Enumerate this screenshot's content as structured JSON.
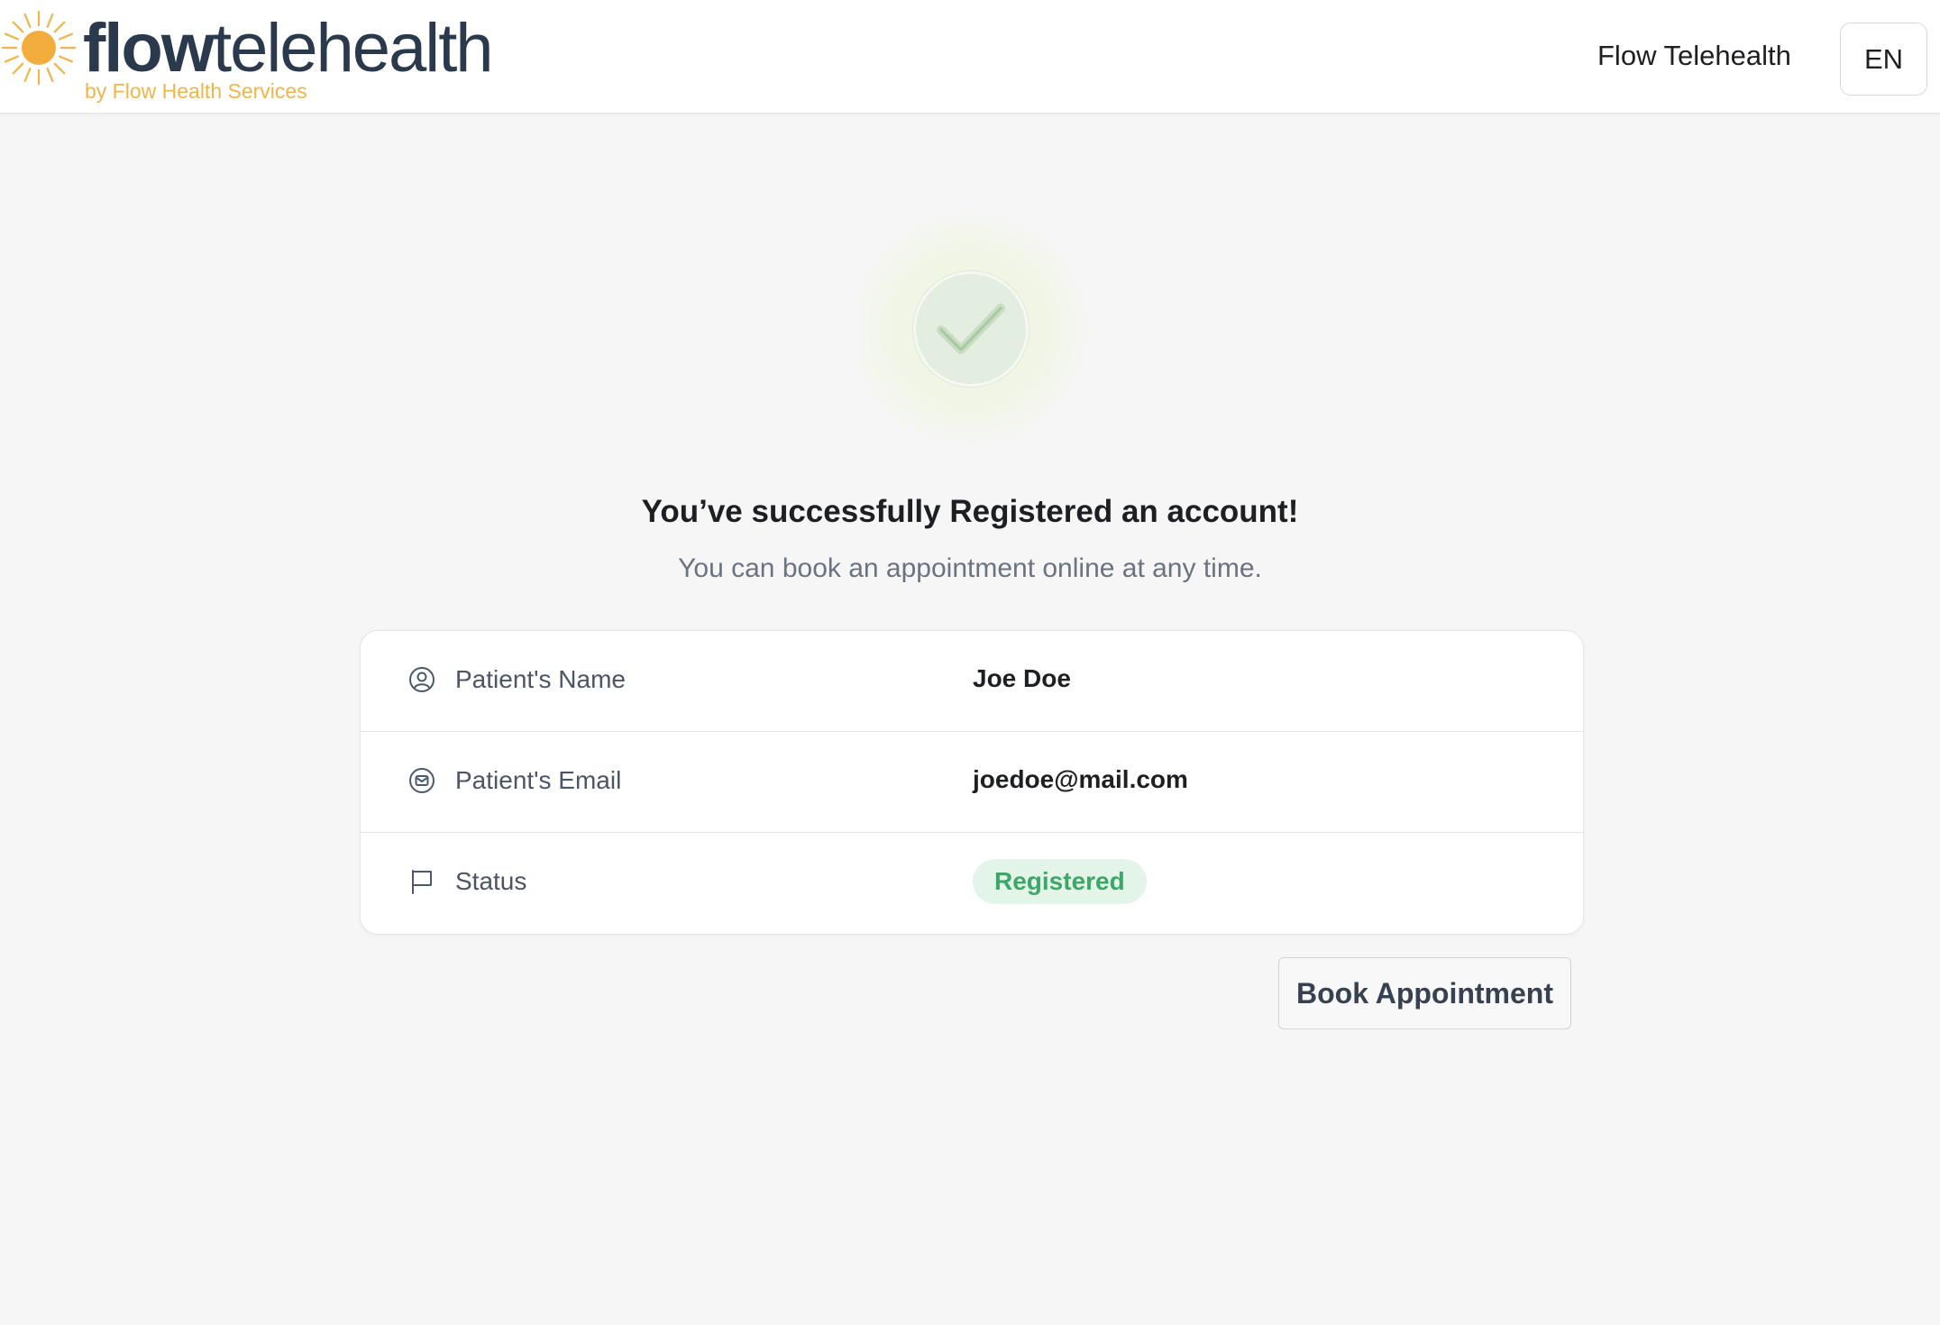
{
  "header": {
    "logo": {
      "word_bold": "flow",
      "word_light": "telehealth",
      "tagline": "by Flow Health Services"
    },
    "nav_title": "Flow Telehealth",
    "language": "EN"
  },
  "success": {
    "icon": "checkmark-icon",
    "title": "You’ve successfully Registered an account!",
    "subtitle": "You can book an appointment online at any time."
  },
  "details": {
    "rows": [
      {
        "icon": "user-circle-icon",
        "label": "Patient's Name",
        "value": "Joe Doe"
      },
      {
        "icon": "mail-circle-icon",
        "label": "Patient's Email",
        "value": "joedoe@mail.com"
      },
      {
        "icon": "flag-icon",
        "label": "Status",
        "value": "Registered"
      }
    ]
  },
  "actions": {
    "book_label": "Book Appointment"
  },
  "colors": {
    "brand_dark": "#2a3a4c",
    "brand_accent": "#f0b54a",
    "status_success_bg": "#e3f4e9",
    "status_success_text": "#3fa66a"
  }
}
